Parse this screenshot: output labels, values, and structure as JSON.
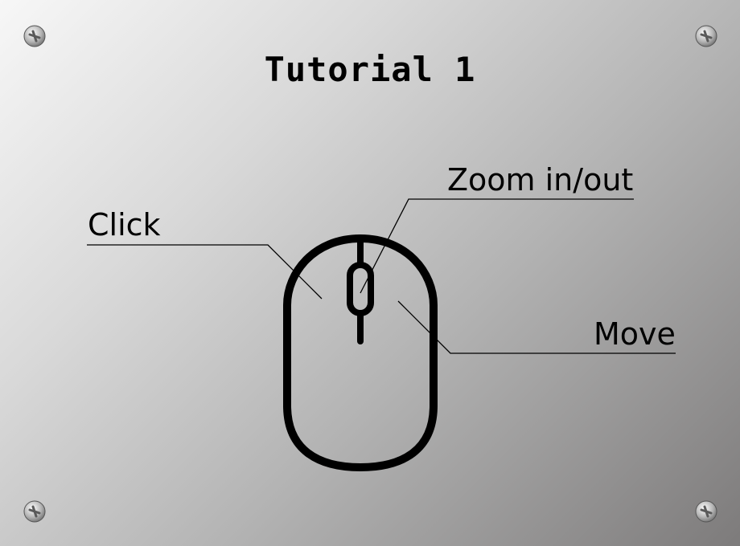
{
  "tutorial": {
    "title": "Tutorial 1",
    "labels": {
      "click": "Click",
      "zoom": "Zoom in/out",
      "move": "Move"
    }
  },
  "icons": {
    "mouse": "mouse-icon",
    "screw": "screw-icon"
  }
}
